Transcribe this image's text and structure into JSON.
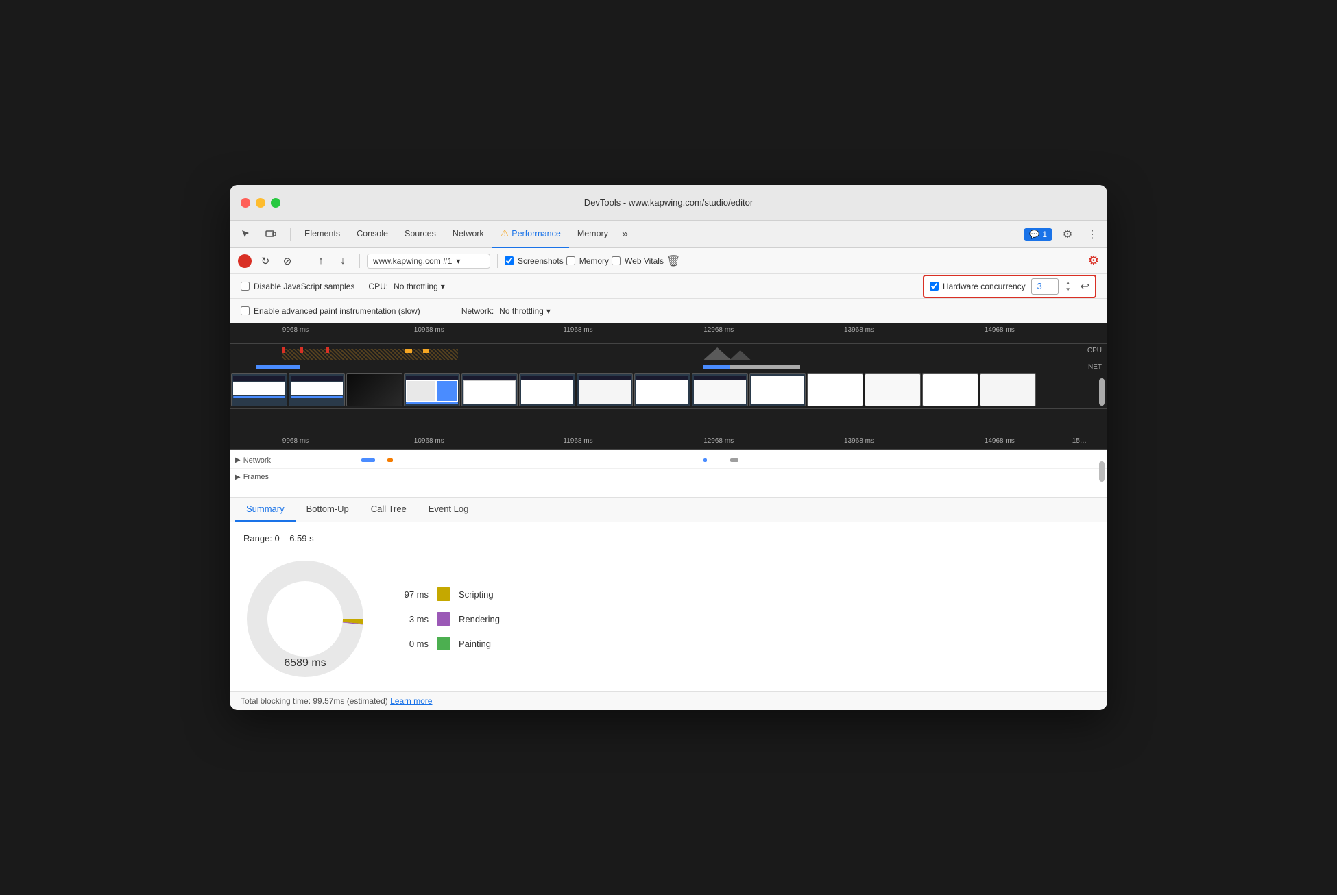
{
  "window": {
    "title": "DevTools - www.kapwing.com/studio/editor"
  },
  "traffic_lights": {
    "red": "close",
    "yellow": "minimize",
    "green": "maximize"
  },
  "devtools_tabs": {
    "cursor_tool": "↖",
    "responsive_tool": "⧉",
    "tabs": [
      {
        "label": "Elements",
        "active": false
      },
      {
        "label": "Console",
        "active": false
      },
      {
        "label": "Sources",
        "active": false
      },
      {
        "label": "Network",
        "active": false
      },
      {
        "label": "Performance",
        "active": true,
        "warn": true
      },
      {
        "label": "Memory",
        "active": false
      }
    ],
    "overflow": "»",
    "badge": "1",
    "badge_icon": "💬"
  },
  "toolbar": {
    "record_label": "●",
    "reload_label": "↻",
    "stop_label": "⊘",
    "upload_label": "↑",
    "download_label": "↓",
    "url_value": "www.kapwing.com #1",
    "screenshots_label": "Screenshots",
    "screenshots_checked": true,
    "memory_label": "Memory",
    "memory_checked": false,
    "webvitals_label": "Web Vitals",
    "webvitals_checked": false,
    "trash_label": "🗑",
    "settings_label": "⚙"
  },
  "settings": {
    "disable_js_samples_label": "Disable JavaScript samples",
    "disable_js_checked": false,
    "cpu_label": "CPU:",
    "cpu_value": "No throttling",
    "hardware_concurrency_label": "Hardware concurrency",
    "hardware_concurrency_checked": true,
    "hardware_concurrency_value": "3",
    "enable_paint_label": "Enable advanced paint instrumentation (slow)",
    "enable_paint_checked": false,
    "network_label": "Network:",
    "network_value": "No throttling"
  },
  "timeline": {
    "rulers": [
      {
        "label": "9968 ms",
        "pos": "8%"
      },
      {
        "label": "10968 ms",
        "pos": "24%"
      },
      {
        "label": "11968 ms",
        "pos": "40%"
      },
      {
        "label": "12968 ms",
        "pos": "56%"
      },
      {
        "label": "13968 ms",
        "pos": "72%"
      },
      {
        "label": "14968 ms",
        "pos": "88%"
      }
    ],
    "cpu_label": "CPU",
    "net_label": "NET"
  },
  "tracks": {
    "network_label": "Network",
    "frames_label": "Frames"
  },
  "bottom_tabs": [
    {
      "label": "Summary",
      "active": true
    },
    {
      "label": "Bottom-Up",
      "active": false
    },
    {
      "label": "Call Tree",
      "active": false
    },
    {
      "label": "Event Log",
      "active": false
    }
  ],
  "summary": {
    "range_label": "Range: 0 – 6.59 s",
    "total_time_label": "6589 ms",
    "legend": [
      {
        "value": "97 ms",
        "color": "#c5a800",
        "name": "Scripting"
      },
      {
        "value": "3 ms",
        "color": "#9b59b6",
        "name": "Rendering"
      },
      {
        "value": "0 ms",
        "color": "#4caf50",
        "name": "Painting"
      }
    ]
  },
  "status_bar": {
    "text": "Total blocking time: 99.57ms (estimated)",
    "link_label": "Learn more"
  }
}
